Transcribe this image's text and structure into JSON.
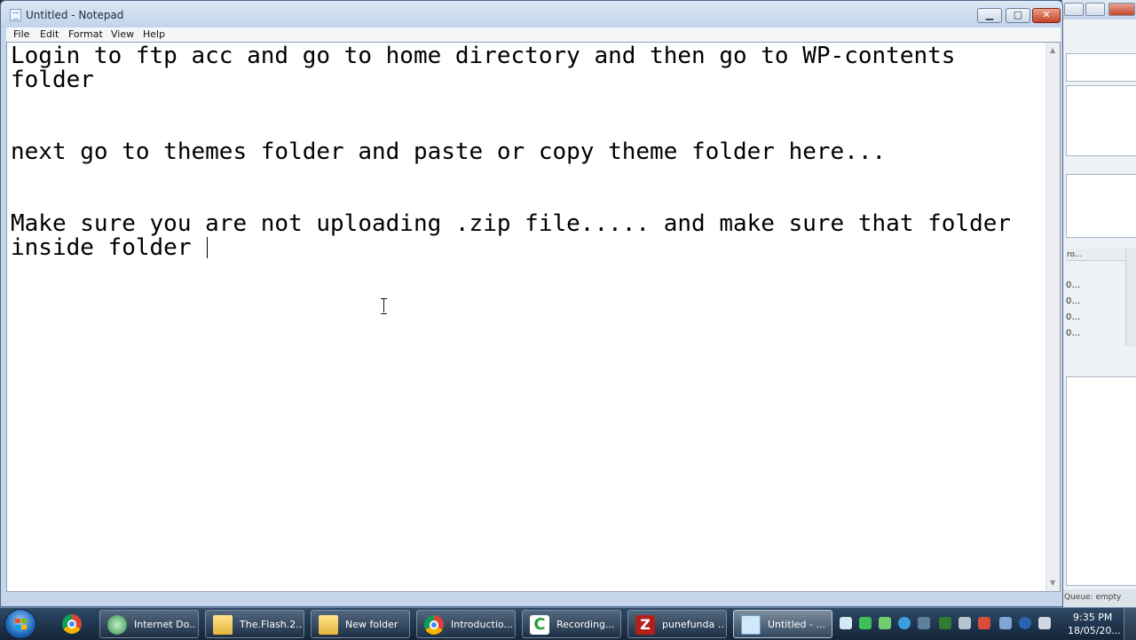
{
  "window": {
    "title": "Untitled - Notepad",
    "buttons": {
      "minimize": "▁",
      "maximize": "▢",
      "close": "✕"
    }
  },
  "menu": [
    "File",
    "Edit",
    "Format",
    "View",
    "Help"
  ],
  "editor": {
    "text": "Login to ftp acc and go to home directory and then go to WP-contents\nfolder\n\n\nnext go to themes folder and paste or copy theme folder here...\n\n\nMake sure you are not uploading .zip file..... and make sure that folder\ninside folder "
  },
  "background_app": {
    "header": "ro...",
    "rows": [
      "0...",
      "0...",
      "0...",
      "0..."
    ],
    "status": "Queue: empty"
  },
  "taskbar": {
    "items": [
      {
        "label": "Internet Do...",
        "icon": "idm-icon"
      },
      {
        "label": "The.Flash.2...",
        "icon": "folder-icon"
      },
      {
        "label": "New folder",
        "icon": "folder-icon"
      },
      {
        "label": "Introductio...",
        "icon": "chrome-icon"
      },
      {
        "label": "Recording...",
        "icon": "camtasia-icon"
      },
      {
        "label": "punefunda ...",
        "icon": "filezilla-icon"
      },
      {
        "label": "Untitled - ...",
        "icon": "notepad-icon",
        "active": true
      }
    ],
    "pinned": [
      "chrome-icon"
    ],
    "clock": {
      "time": "9:35 PM",
      "date": "18/05/20..."
    }
  },
  "colors": {
    "taskbar_top": "#2f4a66",
    "taskbar_bottom": "#13253a",
    "window_frame": "#c6d6ea",
    "close_button": "#c4432a"
  }
}
